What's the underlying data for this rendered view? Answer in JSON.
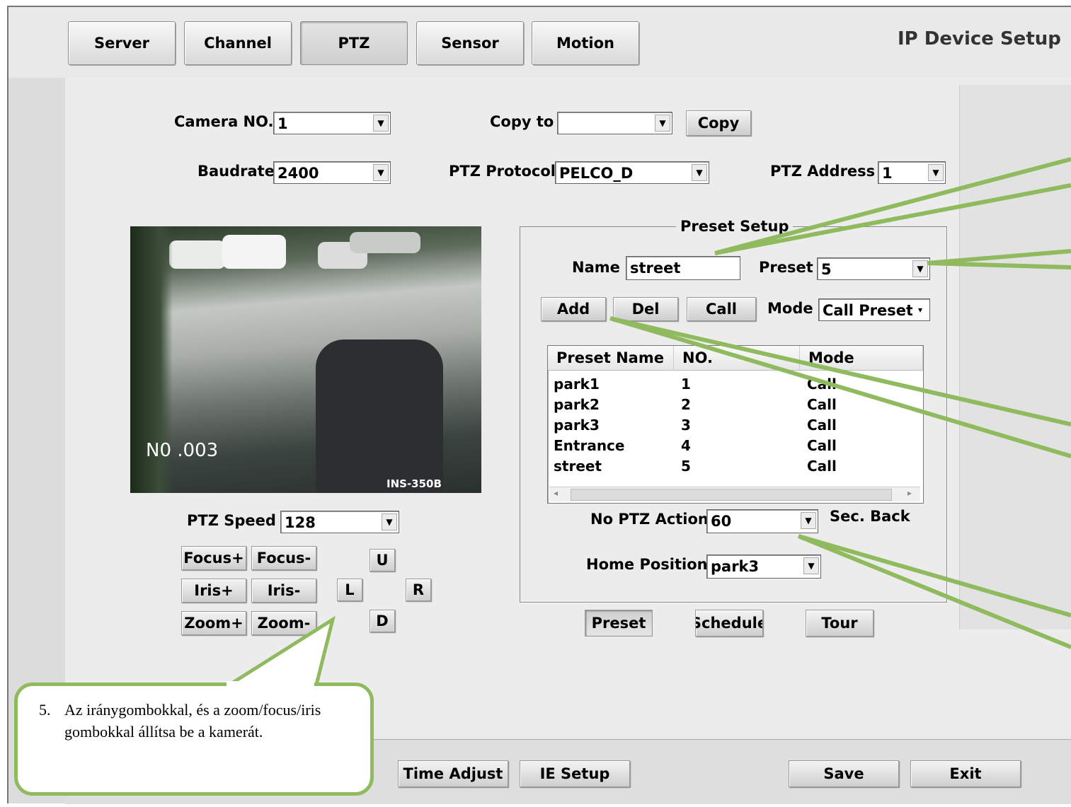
{
  "window": {
    "title": "IP Device Setup"
  },
  "tabs": [
    {
      "label": "Server"
    },
    {
      "label": "Channel"
    },
    {
      "label": "PTZ"
    },
    {
      "label": "Sensor"
    },
    {
      "label": "Motion"
    }
  ],
  "active_tab": "PTZ",
  "settings": {
    "camera_no_label": "Camera NO.",
    "camera_no_value": "1",
    "copy_to_label": "Copy to",
    "copy_to_value": "",
    "copy_button": "Copy",
    "baudrate_label": "Baudrate",
    "baudrate_value": "2400",
    "ptz_protocol_label": "PTZ Protocol",
    "ptz_protocol_value": "PELCO_D",
    "ptz_address_label": "PTZ Address",
    "ptz_address_value": "1"
  },
  "video": {
    "osd_channel": "N0 .003",
    "osd_model": "INS-350B"
  },
  "ptz_controls": {
    "speed_label": "PTZ Speed",
    "speed_value": "128",
    "focus_plus": "Focus+",
    "focus_minus": "Focus-",
    "iris_plus": "Iris+",
    "iris_minus": "Iris-",
    "zoom_plus": "Zoom+",
    "zoom_minus": "Zoom-",
    "up": "U",
    "left": "L",
    "right": "R",
    "down": "D"
  },
  "preset_setup": {
    "group_title": "Preset Setup",
    "name_label": "Name",
    "name_value": "street",
    "preset_label": "Preset",
    "preset_value": "5",
    "add_button": "Add",
    "del_button": "Del",
    "call_button": "Call",
    "mode_label": "Mode",
    "mode_value": "Call Preset",
    "columns": [
      "Preset Name",
      "NO.",
      "Mode"
    ],
    "rows": [
      {
        "name": "park1",
        "no": "1",
        "mode": "Call"
      },
      {
        "name": "park2",
        "no": "2",
        "mode": "Call"
      },
      {
        "name": "park3",
        "no": "3",
        "mode": "Call"
      },
      {
        "name": "Entrance",
        "no": "4",
        "mode": "Call"
      },
      {
        "name": "street",
        "no": "5",
        "mode": "Call"
      }
    ],
    "no_ptz_action_label": "No PTZ Action",
    "no_ptz_action_value": "60",
    "sec_back_label": "Sec. Back",
    "home_position_label": "Home Position",
    "home_position_value": "park3"
  },
  "sub_tabs": {
    "preset": "Preset",
    "schedule": "Schedule",
    "tour": "Tour"
  },
  "bottom_buttons": {
    "time_adjust": "Time Adjust",
    "ie_setup": "IE Setup",
    "save": "Save",
    "exit": "Exit"
  },
  "callout": {
    "number": "5.",
    "text": "Az iránygombokkal, és a zoom/focus/iris gombokkal állítsa be a kamerát."
  },
  "colors": {
    "annotation_green": "#8fba5e",
    "panel_gray": "#ececec"
  }
}
